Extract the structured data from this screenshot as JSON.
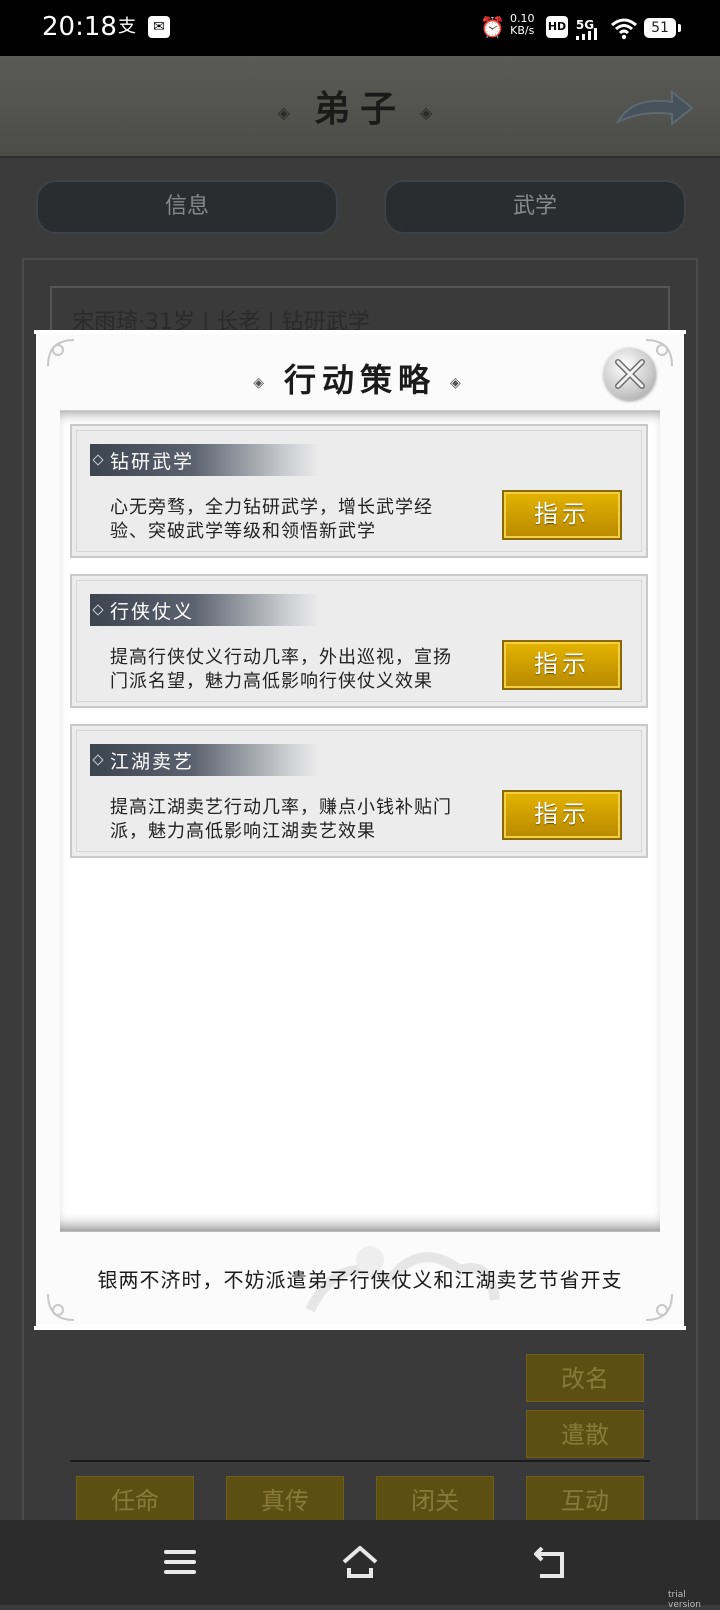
{
  "status_bar": {
    "time": "20:18",
    "speed_value": "0.10",
    "speed_unit": "KB/s",
    "hd": "HD",
    "network": "5G",
    "battery": "51"
  },
  "header": {
    "title": "弟子"
  },
  "tabs": [
    {
      "label": "信息"
    },
    {
      "label": "武学"
    }
  ],
  "disciple_info": "宋雨琦·31岁 | 长老 | 钻研武学",
  "background_buttons": {
    "rename": "改名",
    "dismiss": "遣散",
    "appoint": "任命",
    "true_transmission": "真传",
    "close_door": "闭关",
    "interact": "互动"
  },
  "modal": {
    "title": "行动策略",
    "strategies": [
      {
        "name": "钻研武学",
        "description": "心无旁骛，全力钻研武学，增长武学经验、突破武学等级和领悟新武学",
        "button": "指示"
      },
      {
        "name": "行侠仗义",
        "description": "提高行侠仗义行动几率，外出巡视，宣扬门派名望，魅力高低影响行侠仗义效果",
        "button": "指示"
      },
      {
        "name": "江湖卖艺",
        "description": "提高江湖卖艺行动几率，赚点小钱补贴门派，魅力高低影响江湖卖艺效果",
        "button": "指示"
      }
    ],
    "footer_note": "银两不济时，不妨派遣弟子行侠仗义和江湖卖艺节省开支"
  },
  "watermark": "trial version"
}
